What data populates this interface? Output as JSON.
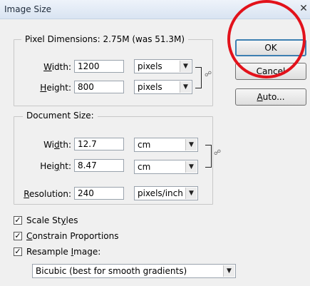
{
  "window": {
    "title": "Image Size",
    "close_glyph": "✕"
  },
  "pixel_dimensions": {
    "legend": "Pixel Dimensions:",
    "size_text": "2.75M (was 51.3M)",
    "width_label": "Width:",
    "width_value": "1200",
    "width_unit": "pixels",
    "height_label": "Height:",
    "height_value": "800",
    "height_unit": "pixels"
  },
  "document_size": {
    "legend": "Document Size:",
    "width_label": "Width:",
    "width_value": "12.7",
    "width_unit": "cm",
    "height_label": "Height:",
    "height_value": "8.47",
    "height_unit": "cm",
    "resolution_label": "Resolution:",
    "resolution_value": "240",
    "resolution_unit": "pixels/inch"
  },
  "options": {
    "scale_styles": {
      "label": "Scale Styles",
      "checked": true
    },
    "constrain_proportions": {
      "label": "Constrain Proportions",
      "checked": true
    },
    "resample_image": {
      "label": "Resample Image:",
      "checked": true
    },
    "resample_method": "Bicubic (best for smooth gradients)"
  },
  "buttons": {
    "ok": "OK",
    "cancel": "Cancel",
    "auto": "Auto..."
  },
  "colors": {
    "highlight_ring": "#e2121b",
    "default_button_border": "#3c7fb1"
  },
  "icons": {
    "link": "chain-link-icon",
    "dropdown": "chevron-down-icon",
    "check": "checkmark-icon"
  }
}
